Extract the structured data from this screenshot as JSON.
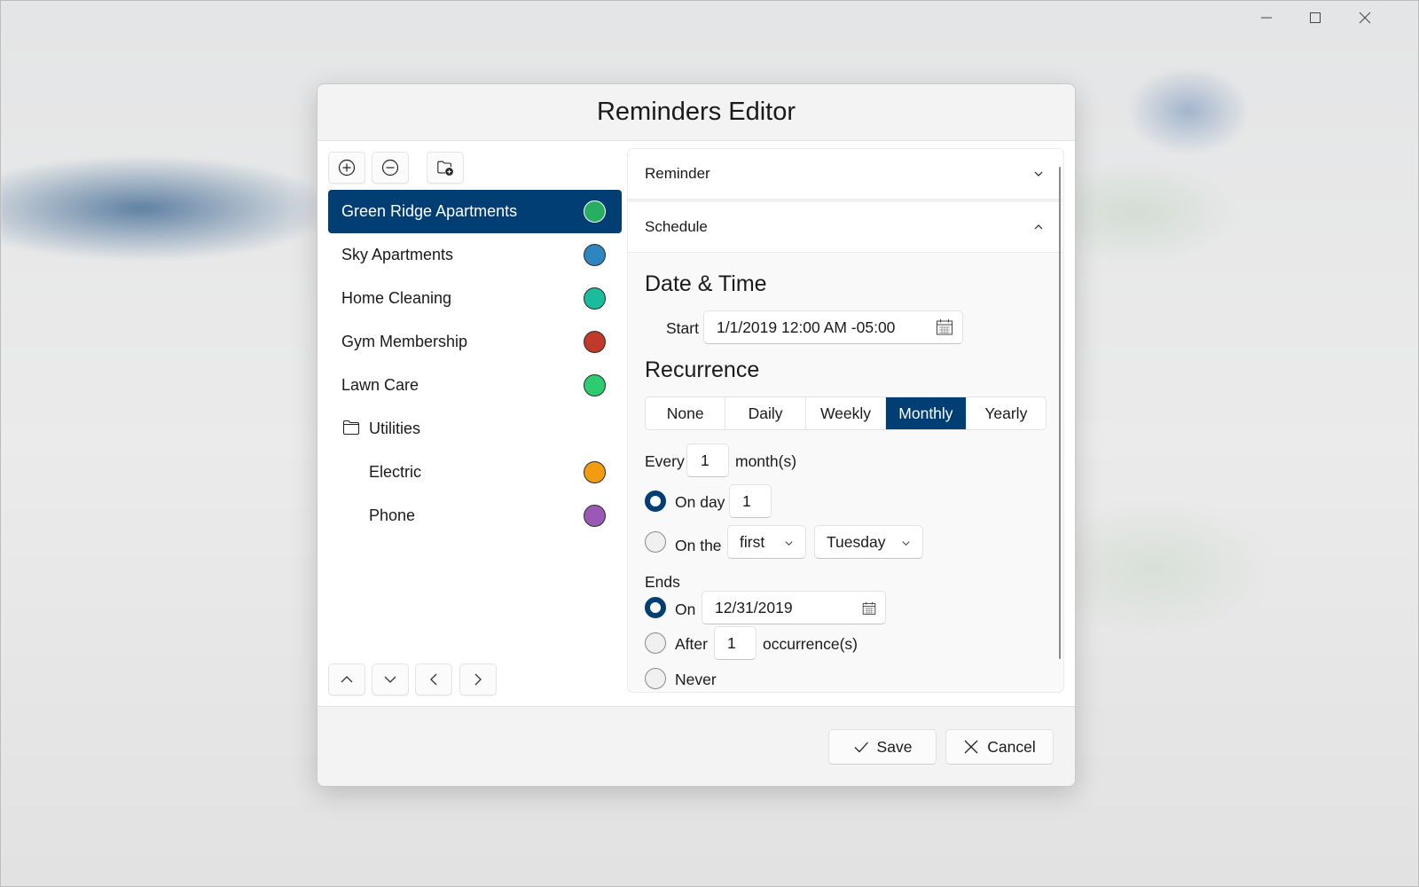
{
  "window": {
    "controls": {
      "minimize_icon": "minimize-icon",
      "maximize_icon": "maximize-icon",
      "close_icon": "close-icon"
    }
  },
  "dialog": {
    "title": "Reminders Editor"
  },
  "toolbar": {
    "add_icon": "plus-circle-icon",
    "remove_icon": "minus-circle-icon",
    "add_folder_icon": "folder-add-icon"
  },
  "list": {
    "items": [
      {
        "label": "Green Ridge Apartments",
        "color": "#27ae60",
        "selected": true,
        "type": "reminder"
      },
      {
        "label": "Sky Apartments",
        "color": "#2e86c1",
        "selected": false,
        "type": "reminder"
      },
      {
        "label": "Home Cleaning",
        "color": "#1abc9c",
        "selected": false,
        "type": "reminder"
      },
      {
        "label": "Gym Membership",
        "color": "#c0392b",
        "selected": false,
        "type": "reminder"
      },
      {
        "label": "Lawn Care",
        "color": "#2ecc71",
        "selected": false,
        "type": "reminder"
      },
      {
        "label": "Utilities",
        "type": "folder",
        "icon": "folder-icon"
      },
      {
        "label": "Electric",
        "color": "#f39c12",
        "selected": false,
        "type": "reminder",
        "child": true
      },
      {
        "label": "Phone",
        "color": "#9b59b6",
        "selected": false,
        "type": "reminder",
        "child": true
      }
    ]
  },
  "nav": {
    "up_icon": "chevron-up-icon",
    "down_icon": "chevron-down-icon",
    "left_icon": "chevron-left-icon",
    "right_icon": "chevron-right-icon"
  },
  "expanders": {
    "reminder": {
      "label": "Reminder",
      "expanded": false
    },
    "schedule": {
      "label": "Schedule",
      "expanded": true
    }
  },
  "schedule": {
    "date_time_title": "Date & Time",
    "start_label": "Start",
    "start_value": "1/1/2019 12:00 AM -05:00",
    "recurrence_title": "Recurrence",
    "recurrence_options": [
      "None",
      "Daily",
      "Weekly",
      "Monthly",
      "Yearly"
    ],
    "recurrence_selected": "Monthly",
    "every_label": "Every",
    "every_value": "1",
    "every_unit": "month(s)",
    "on_day_label": "On day",
    "on_day_value": "1",
    "on_day_checked": true,
    "on_the_label": "On the",
    "on_the_checked": false,
    "on_the_ordinal": "first",
    "on_the_weekday": "Tuesday",
    "ends_label": "Ends",
    "ends_on_label": "On",
    "ends_on_value": "12/31/2019",
    "ends_on_checked": true,
    "ends_after_label": "After",
    "ends_after_value": "1",
    "ends_after_unit": "occurrence(s)",
    "ends_after_checked": false,
    "ends_never_label": "Never",
    "ends_never_checked": false
  },
  "footer": {
    "save_label": "Save",
    "cancel_label": "Cancel"
  }
}
